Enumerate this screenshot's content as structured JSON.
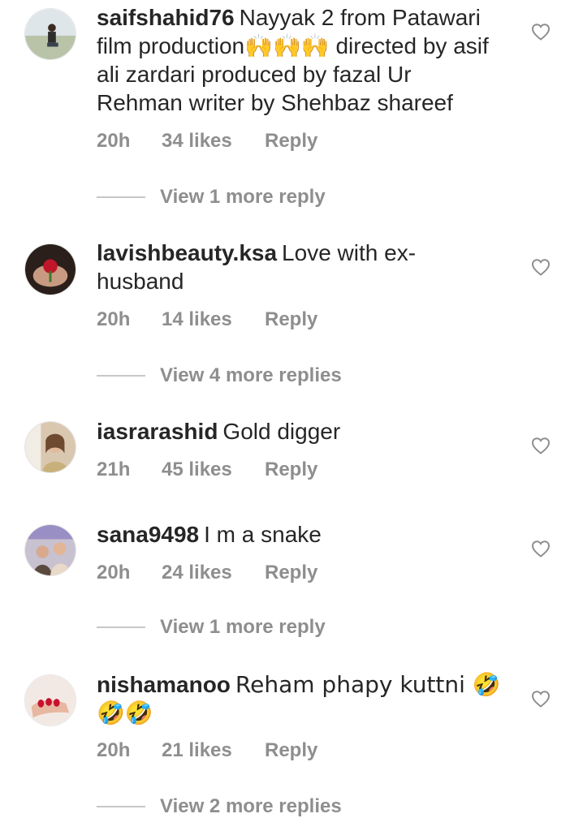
{
  "comments": [
    {
      "username": "saifshahid76",
      "text": "Nayyak 2 from Patawari film production🙌🙌🙌 directed by asif ali zardari produced by fazal Ur Rehman writer by Shehbaz shareef",
      "time": "20h",
      "likes": "34 likes",
      "reply": "Reply",
      "more": "View 1 more reply",
      "avatar": "man-outdoors-avatar"
    },
    {
      "username": "lavishbeauty.ksa",
      "text": "Love with ex-husband",
      "time": "20h",
      "likes": "14 likes",
      "reply": "Reply",
      "more": "View 4 more replies",
      "avatar": "hands-rose-avatar"
    },
    {
      "username": "iasrarashid",
      "text": "Gold digger",
      "time": "21h",
      "likes": "45 likes",
      "reply": "Reply",
      "more": "",
      "avatar": "woman-portrait-avatar"
    },
    {
      "username": "sana9498",
      "text": "I m a snake",
      "time": "20h",
      "likes": "24 likes",
      "reply": "Reply",
      "more": "View 1 more reply",
      "avatar": "women-group-avatar"
    },
    {
      "username": "nishamanoo",
      "text": "Reham phapy kuttni 🤣🤣🤣",
      "time": "20h",
      "likes": "21 likes",
      "reply": "Reply",
      "more": "View 2 more replies",
      "avatar": "hand-nails-avatar"
    }
  ],
  "colors": {
    "text": "#262626",
    "secondary": "#8e8e8e",
    "divider": "#c7c7c7"
  },
  "icons": {
    "like": "heart-outline-icon"
  }
}
